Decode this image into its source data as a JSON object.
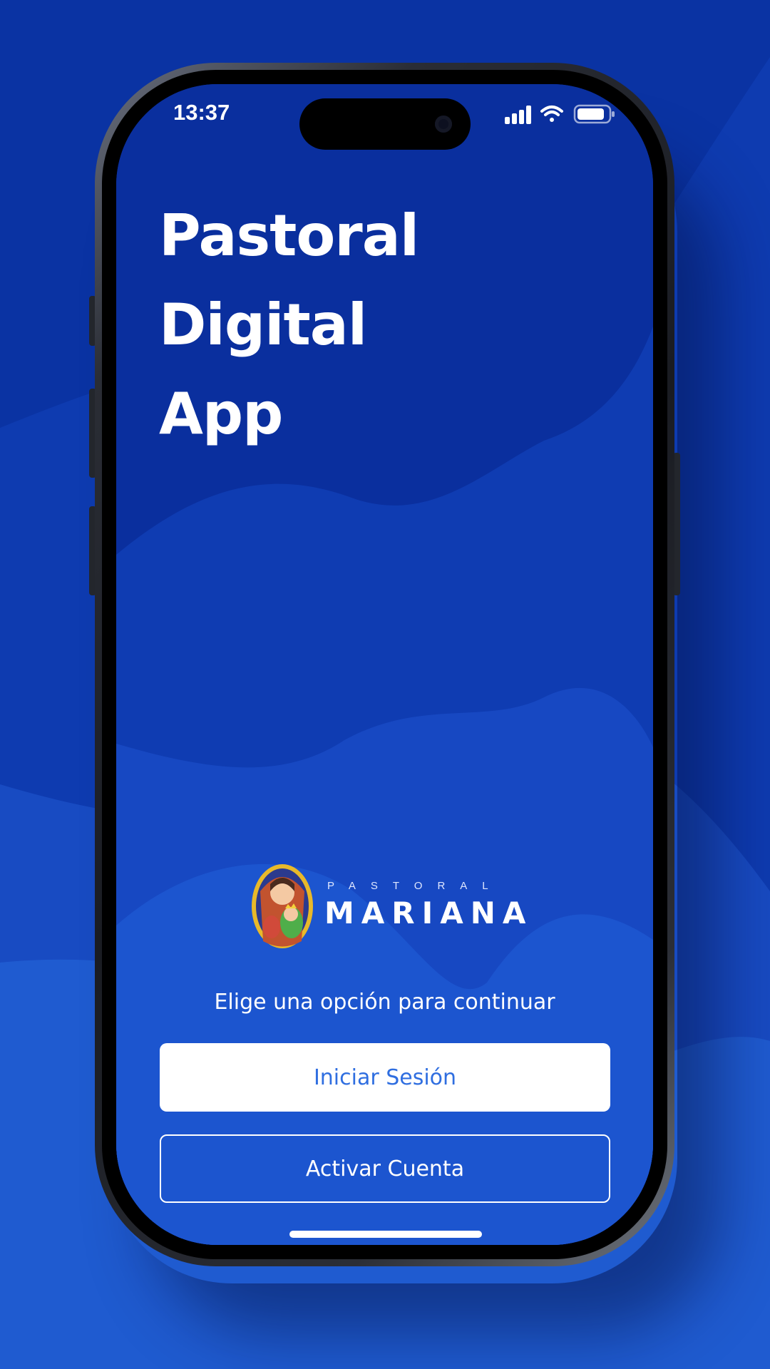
{
  "status_bar": {
    "time": "13:37"
  },
  "app": {
    "title_lines": [
      "Pastoral",
      "Digital",
      "App"
    ]
  },
  "logo": {
    "small_text": "PASTORAL",
    "big_text": "MARIANA"
  },
  "prompt": "Elige una opción para continuar",
  "buttons": {
    "login": "Iniciar Sesión",
    "activate": "Activar Cuenta"
  },
  "colors": {
    "background": "#0b34a6",
    "screen_top": "#0a2f9e",
    "button_text_primary": "#2f6ee0",
    "text": "#ffffff"
  },
  "icons": [
    "signal-icon",
    "wifi-icon",
    "battery-icon",
    "mariana-badge-icon"
  ]
}
